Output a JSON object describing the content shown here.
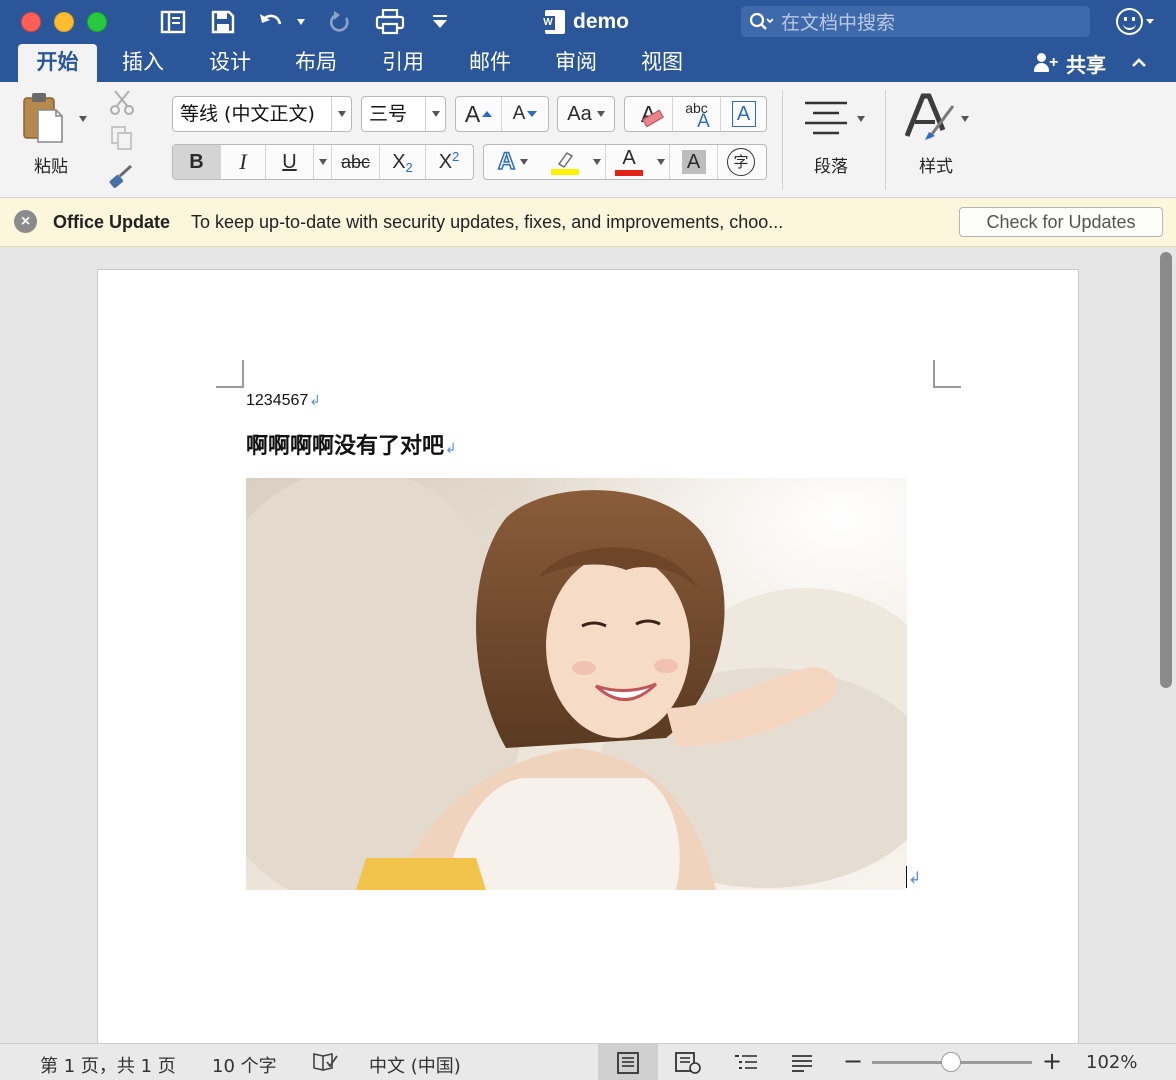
{
  "window": {
    "title": "demo",
    "search_placeholder": "在文档中搜索"
  },
  "tabs": [
    "开始",
    "插入",
    "设计",
    "布局",
    "引用",
    "邮件",
    "审阅",
    "视图"
  ],
  "active_tab": "开始",
  "share_label": "共享",
  "ribbon": {
    "paste_label": "粘贴",
    "font_name": "等线 (中文正文)",
    "font_size": "三号",
    "grow_font": "A",
    "shrink_font": "A",
    "change_case": "Aa",
    "clear_format_glyph": "A",
    "phonetic_top": "abc",
    "phonetic_bottom": "A",
    "char_border": "A",
    "bold": "B",
    "italic": "I",
    "underline": "U",
    "strikethrough": "abc",
    "subscript": "X",
    "subscript_small": "2",
    "superscript": "X",
    "superscript_small": "2",
    "text_effects": "A",
    "font_color": "A",
    "char_shading": "A",
    "enclose_char": "字",
    "paragraph_label": "段落",
    "styles_label": "样式",
    "highlight_color": "#fff200",
    "font_color_value": "#e2231a"
  },
  "update_bar": {
    "title": "Office Update",
    "message": "To keep up-to-date with security updates, fixes, and improvements, choo...",
    "button": "Check for Updates"
  },
  "document": {
    "line1": "1234567",
    "line2": "啊啊啊啊没有了对吧",
    "paragraph_mark": "↲"
  },
  "status": {
    "page": "第 1 页，共 1 页",
    "words": "10 个字",
    "language": "中文 (中国)",
    "zoom_minus": "−",
    "zoom_plus": "+",
    "zoom": "102%",
    "zoom_level_percent": 102
  }
}
